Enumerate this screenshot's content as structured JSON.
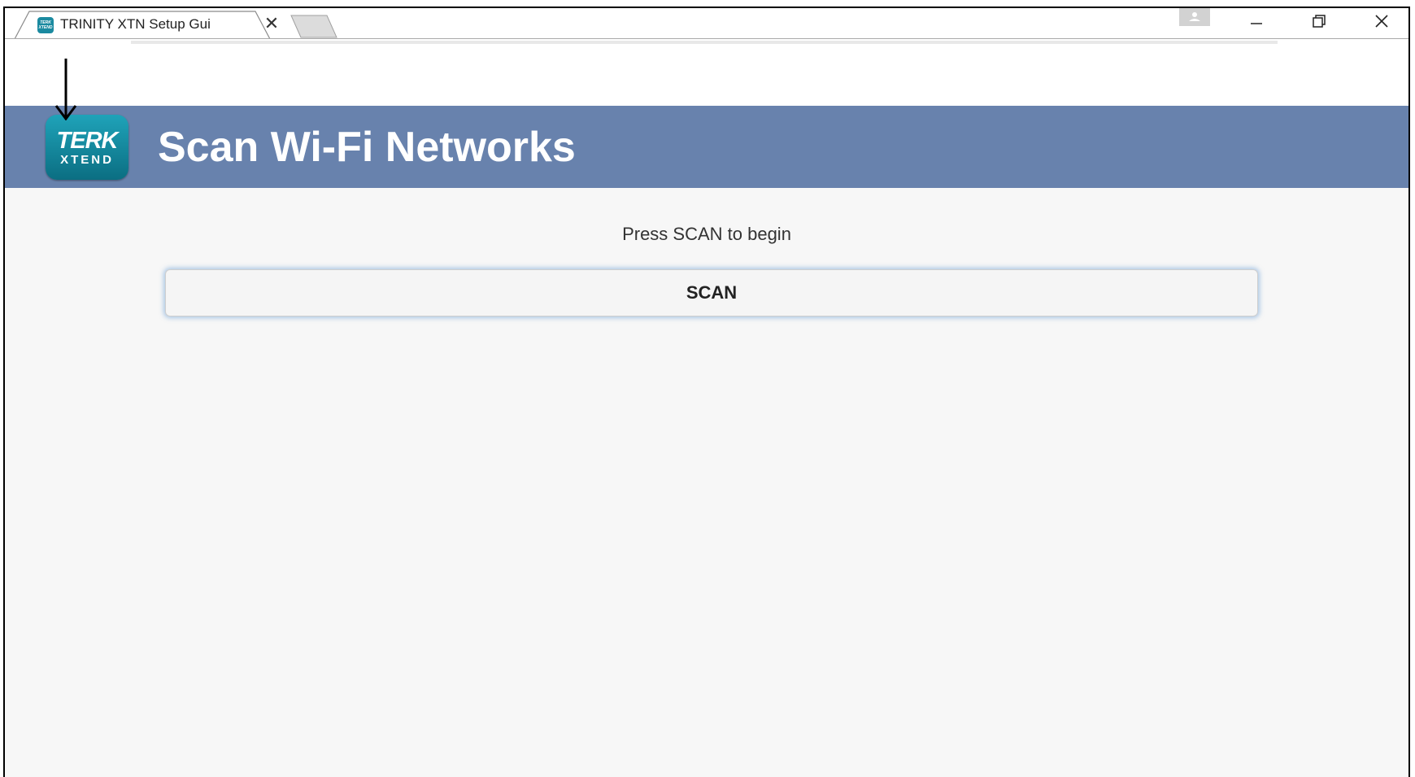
{
  "browser": {
    "tab": {
      "title": "TRINITY XTN Setup Gui",
      "favicon": "terk-xtend-favicon",
      "close_icon": "close-icon"
    },
    "window_controls": [
      "minimize-icon",
      "restore-icon",
      "close-icon"
    ]
  },
  "header": {
    "background": "#6882ad",
    "logo": {
      "line1": "TERK",
      "line2": "XTEND"
    },
    "title": "Scan Wi-Fi Networks"
  },
  "main": {
    "prompt": "Press SCAN to begin",
    "scan_button_label": "SCAN"
  },
  "annotation": {
    "icon": "down-arrow-icon",
    "color": "#000000"
  }
}
